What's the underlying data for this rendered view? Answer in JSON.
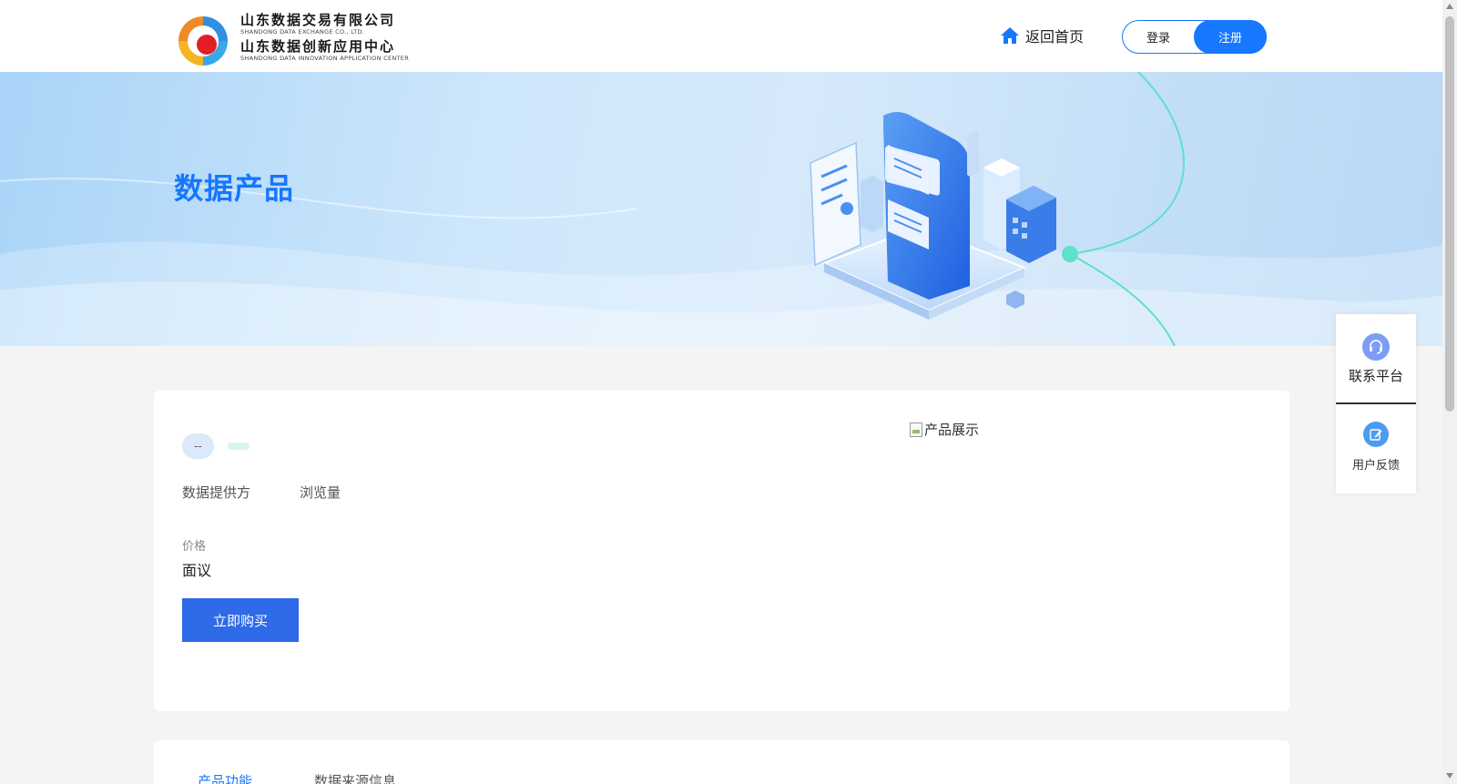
{
  "header": {
    "logo": {
      "line1_cn": "山东数据交易有限公司",
      "line1_en": "SHANDONG DATA EXCHANGE CO., LTD.",
      "line2_cn": "山东数据创新应用中心",
      "line2_en": "SHANDONG DATA INNOVATION APPLICATION CENTER"
    },
    "home_label": "返回首页",
    "login_label": "登录",
    "register_label": "注册",
    "accent_color": "#1677ff"
  },
  "banner": {
    "title": "数据产品"
  },
  "product": {
    "tag_gray": "--",
    "provider_label": "数据提供方",
    "views_label": "浏览量",
    "price_label": "价格",
    "price_value": "面议",
    "buy_label": "立即购买",
    "image_alt": "产品展示"
  },
  "tabs": [
    {
      "label": "产品功能",
      "active": true
    },
    {
      "label": "数据来源信息",
      "active": false
    }
  ],
  "float_panel": {
    "contact_label": "联系平台",
    "contact_icon": "headset-icon",
    "feedback_label": "用户反馈",
    "feedback_icon": "edit-icon"
  }
}
